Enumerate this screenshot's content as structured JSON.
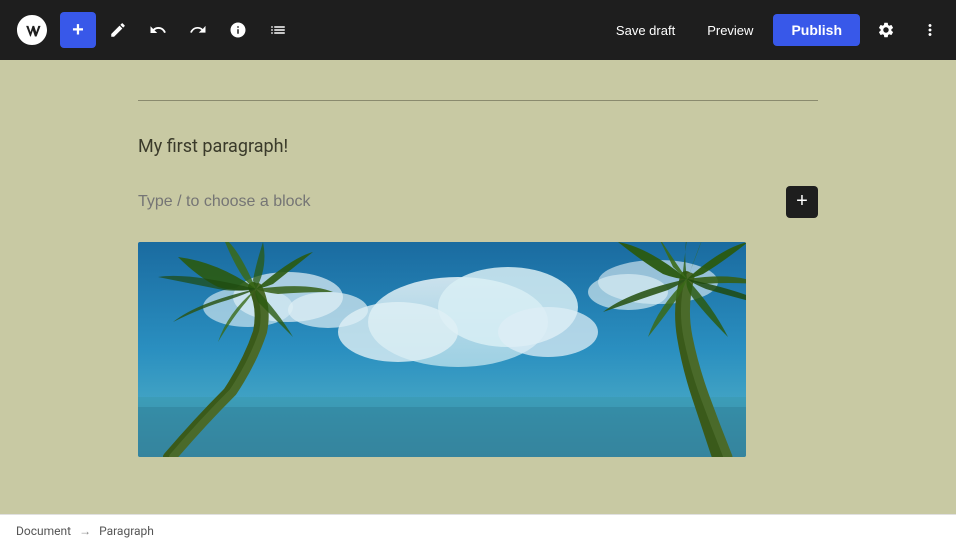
{
  "toolbar": {
    "add_label": "+",
    "save_draft_label": "Save draft",
    "preview_label": "Preview",
    "publish_label": "Publish"
  },
  "editor": {
    "paragraph_text": "My first paragraph!",
    "add_block_placeholder": "Type / to choose a block"
  },
  "status_bar": {
    "document_label": "Document",
    "arrow": "→",
    "paragraph_label": "Paragraph"
  },
  "icons": {
    "add": "+",
    "brush": "✏",
    "undo": "↩",
    "redo": "↪",
    "info": "ⓘ",
    "list": "☰",
    "settings": "⚙",
    "more": "⋮",
    "block_add": "+"
  }
}
